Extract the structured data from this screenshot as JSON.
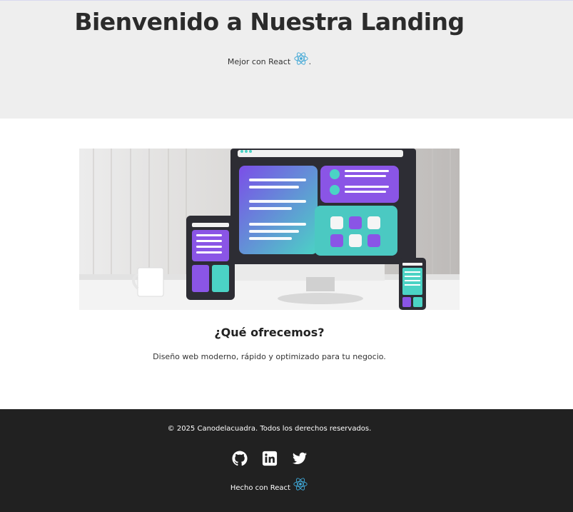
{
  "header": {
    "title": "Bienvenido a Nuestra Landing",
    "subtitle": "Mejor con React",
    "subtitle_suffix": ".",
    "background": "#eeeeee"
  },
  "main": {
    "hero_image_icon": "responsive-devices-illustration",
    "section_title": "¿Qué ofrecemos?",
    "section_text": "Diseño web moderno, rápido y optimizado para tu negocio."
  },
  "footer": {
    "copyright": "© 2025 Canodelacuadra. Todos los derechos reservados.",
    "social": [
      {
        "name": "github-icon"
      },
      {
        "name": "linkedin-icon"
      },
      {
        "name": "twitter-icon"
      }
    ],
    "made_with": "Hecho con React",
    "background": "#212121"
  },
  "colors": {
    "react": "#3fa7d6",
    "purple": "#8a55e6",
    "teal": "#3fc9c2"
  }
}
